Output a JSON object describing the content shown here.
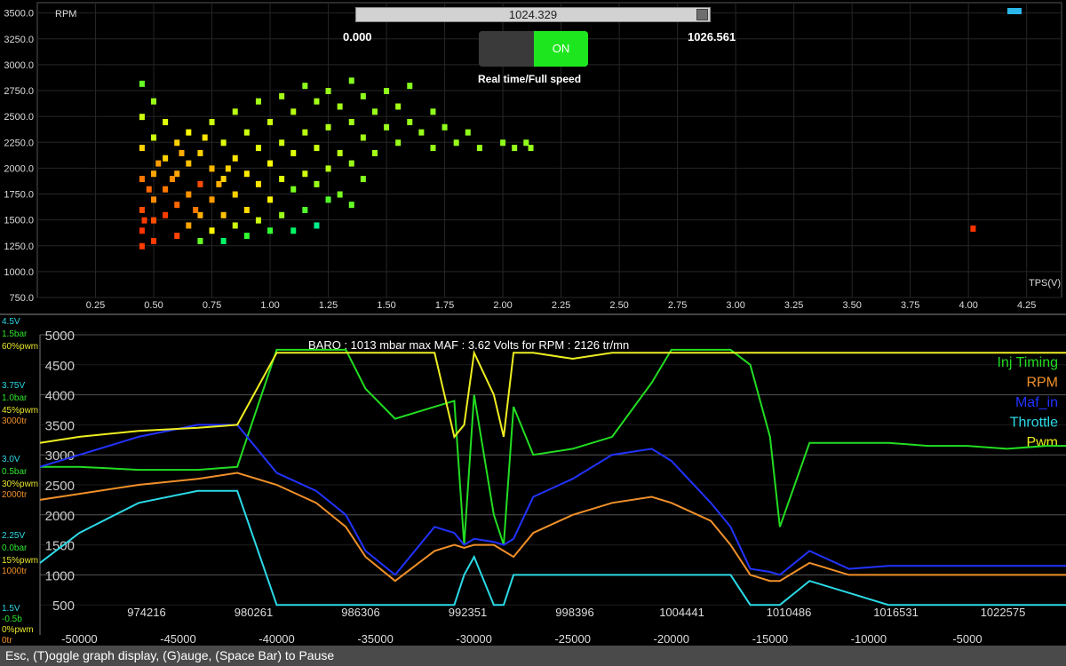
{
  "scatter": {
    "y_axis_title": "RPM",
    "x_axis_title": "TPS(V)",
    "y_ticks": [
      "3500.0",
      "3250.0",
      "3000.0",
      "2750.0",
      "2500.0",
      "2250.0",
      "2000.0",
      "1750.0",
      "1500.0",
      "1250.0",
      "1000.0",
      "750.0"
    ],
    "x_ticks": [
      "0.25",
      "0.50",
      "0.75",
      "1.00",
      "1.25",
      "1.50",
      "1.75",
      "2.00",
      "2.25",
      "2.50",
      "2.75",
      "3.00",
      "3.25",
      "3.50",
      "3.75",
      "4.00",
      "4.25"
    ],
    "xlim": [
      0.0,
      4.4
    ],
    "ylim": [
      750,
      3600
    ]
  },
  "slider": {
    "value": "1024.329",
    "min_label": "0.000",
    "max_label": "1026.561",
    "fraction": 0.997
  },
  "toggle": {
    "state_label": "ON",
    "caption": "Real time/Full speed"
  },
  "colorbar": {
    "ticks": [
      "0",
      "25",
      "50",
      "75",
      "100"
    ],
    "colors": [
      "#0000ff",
      "#00d4ff",
      "#00ff40",
      "#ffff00",
      "#ff2000"
    ]
  },
  "timeseries": {
    "header": "BARO : 1013 mbar   max MAF  : 3.62 Volts for RPM : 2126 tr/mn",
    "y_ticks": [
      "5000",
      "4500",
      "4000",
      "3500",
      "3000",
      "2500",
      "2000",
      "1500",
      "1000",
      "500"
    ],
    "x_bottom_ticks": [
      "-50000",
      "-45000",
      "-40000",
      "-35000",
      "-30000",
      "-25000",
      "-20000",
      "-15000",
      "-10000",
      "-5000"
    ],
    "x_top_ticks": [
      "974216",
      "980261",
      "986306",
      "992351",
      "998396",
      "1004441",
      "1010486",
      "1016531",
      "1022575"
    ],
    "left_scale": [
      {
        "label": "4.5V",
        "color": "#2bd9e6"
      },
      {
        "label": "1.5bar",
        "color": "#2ee62e"
      },
      {
        "label": "60%pwm",
        "color": "#e6e62e"
      },
      {
        "label": "3.75V",
        "color": "#2bd9e6"
      },
      {
        "label": "1.0bar",
        "color": "#2ee62e"
      },
      {
        "label": "45%pwm",
        "color": "#e6e62e"
      },
      {
        "label": "3000tr",
        "color": "#f0902a"
      },
      {
        "label": "3.0V",
        "color": "#2bd9e6"
      },
      {
        "label": "0.5bar",
        "color": "#2ee62e"
      },
      {
        "label": "30%pwm",
        "color": "#e6e62e"
      },
      {
        "label": "2000tr",
        "color": "#f0902a"
      },
      {
        "label": "2.25V",
        "color": "#2bd9e6"
      },
      {
        "label": "0.0bar",
        "color": "#2ee62e"
      },
      {
        "label": "15%pwm",
        "color": "#e6e62e"
      },
      {
        "label": "1000tr",
        "color": "#f0902a"
      },
      {
        "label": "1.5V",
        "color": "#2bd9e6"
      },
      {
        "label": "-0.5b",
        "color": "#2ee62e"
      },
      {
        "label": "0%pwm",
        "color": "#e6e62e"
      },
      {
        "label": "0tr",
        "color": "#f0902a"
      }
    ],
    "legend": [
      {
        "name": "Inj Timing",
        "color": "#22dd22"
      },
      {
        "name": "RPM",
        "color": "#f0902a"
      },
      {
        "name": "Maf_in",
        "color": "#2233ff"
      },
      {
        "name": "Throttle",
        "color": "#2bd9e6"
      },
      {
        "name": "Pwm",
        "color": "#eeee22"
      }
    ]
  },
  "chart_data": [
    {
      "type": "scatter",
      "xlabel": "TPS(V)",
      "ylabel": "RPM",
      "xlim": [
        0.0,
        4.4
      ],
      "ylim": [
        750,
        3600
      ],
      "points": [
        [
          0.45,
          2820,
          60
        ],
        [
          0.45,
          2500,
          70
        ],
        [
          0.45,
          2200,
          80
        ],
        [
          0.45,
          1900,
          90
        ],
        [
          0.45,
          1600,
          95
        ],
        [
          0.45,
          1400,
          98
        ],
        [
          0.45,
          1250,
          97
        ],
        [
          0.5,
          2650,
          65
        ],
        [
          0.5,
          2300,
          70
        ],
        [
          0.5,
          1950,
          85
        ],
        [
          0.5,
          1700,
          88
        ],
        [
          0.5,
          1500,
          95
        ],
        [
          0.5,
          1300,
          97
        ],
        [
          0.55,
          2450,
          72
        ],
        [
          0.55,
          2100,
          80
        ],
        [
          0.55,
          1800,
          90
        ],
        [
          0.55,
          1550,
          97
        ],
        [
          0.6,
          2250,
          80
        ],
        [
          0.6,
          1950,
          85
        ],
        [
          0.6,
          1650,
          92
        ],
        [
          0.6,
          1350,
          96
        ],
        [
          0.65,
          2350,
          75
        ],
        [
          0.65,
          2050,
          82
        ],
        [
          0.65,
          1750,
          87
        ],
        [
          0.65,
          1450,
          85
        ],
        [
          0.7,
          2150,
          80
        ],
        [
          0.7,
          1850,
          95
        ],
        [
          0.7,
          1550,
          84
        ],
        [
          0.7,
          1300,
          60
        ],
        [
          0.75,
          2450,
          70
        ],
        [
          0.75,
          2000,
          83
        ],
        [
          0.75,
          1700,
          86
        ],
        [
          0.75,
          1400,
          76
        ],
        [
          0.8,
          2250,
          72
        ],
        [
          0.8,
          1900,
          80
        ],
        [
          0.8,
          1550,
          82
        ],
        [
          0.8,
          1300,
          45
        ],
        [
          0.85,
          2550,
          68
        ],
        [
          0.85,
          2100,
          78
        ],
        [
          0.85,
          1750,
          80
        ],
        [
          0.85,
          1450,
          70
        ],
        [
          0.9,
          2350,
          70
        ],
        [
          0.9,
          1950,
          77
        ],
        [
          0.9,
          1600,
          79
        ],
        [
          0.9,
          1350,
          55
        ],
        [
          0.95,
          2650,
          66
        ],
        [
          0.95,
          2200,
          72
        ],
        [
          0.95,
          1850,
          78
        ],
        [
          0.95,
          1500,
          70
        ],
        [
          1.0,
          2450,
          70
        ],
        [
          1.0,
          2050,
          75
        ],
        [
          1.0,
          1700,
          76
        ],
        [
          1.0,
          1400,
          55
        ],
        [
          1.05,
          2700,
          66
        ],
        [
          1.05,
          2250,
          70
        ],
        [
          1.05,
          1900,
          72
        ],
        [
          1.05,
          1550,
          65
        ],
        [
          1.1,
          2550,
          68
        ],
        [
          1.1,
          2150,
          72
        ],
        [
          1.1,
          1800,
          62
        ],
        [
          1.1,
          1400,
          45
        ],
        [
          1.15,
          2800,
          64
        ],
        [
          1.15,
          2350,
          68
        ],
        [
          1.15,
          1950,
          70
        ],
        [
          1.15,
          1600,
          58
        ],
        [
          1.2,
          2650,
          66
        ],
        [
          1.2,
          2200,
          70
        ],
        [
          1.2,
          1850,
          65
        ],
        [
          1.2,
          1450,
          40
        ],
        [
          1.25,
          2750,
          65
        ],
        [
          1.25,
          2400,
          67
        ],
        [
          1.25,
          2000,
          68
        ],
        [
          1.25,
          1700,
          58
        ],
        [
          1.3,
          2600,
          66
        ],
        [
          1.3,
          2150,
          68
        ],
        [
          1.3,
          1750,
          62
        ],
        [
          1.35,
          2850,
          63
        ],
        [
          1.35,
          2450,
          66
        ],
        [
          1.35,
          2050,
          65
        ],
        [
          1.35,
          1650,
          60
        ],
        [
          1.4,
          2700,
          64
        ],
        [
          1.4,
          2300,
          66
        ],
        [
          1.4,
          1900,
          63
        ],
        [
          1.45,
          2550,
          65
        ],
        [
          1.45,
          2150,
          66
        ],
        [
          1.5,
          2750,
          64
        ],
        [
          1.5,
          2400,
          65
        ],
        [
          1.55,
          2600,
          66
        ],
        [
          1.55,
          2250,
          65
        ],
        [
          1.6,
          2800,
          63
        ],
        [
          1.6,
          2450,
          65
        ],
        [
          1.65,
          2350,
          65
        ],
        [
          1.7,
          2550,
          64
        ],
        [
          1.7,
          2200,
          65
        ],
        [
          1.75,
          2400,
          64
        ],
        [
          1.8,
          2250,
          65
        ],
        [
          1.85,
          2350,
          64
        ],
        [
          1.9,
          2200,
          65
        ],
        [
          2.0,
          2250,
          64
        ],
        [
          2.05,
          2200,
          65
        ],
        [
          2.1,
          2250,
          64
        ],
        [
          2.12,
          2200,
          65
        ],
        [
          4.02,
          1420,
          98
        ],
        [
          0.46,
          1500,
          97
        ],
        [
          0.48,
          1800,
          92
        ],
        [
          0.52,
          2050,
          86
        ],
        [
          0.58,
          1900,
          88
        ],
        [
          0.62,
          2150,
          84
        ],
        [
          0.68,
          1600,
          90
        ],
        [
          0.72,
          2300,
          78
        ],
        [
          0.78,
          1850,
          84
        ],
        [
          0.82,
          2000,
          80
        ]
      ]
    },
    {
      "type": "line",
      "xlabel": "",
      "ylabel": "",
      "x": [
        -52000,
        -50000,
        -47000,
        -44000,
        -42000,
        -40000,
        -38000,
        -36500,
        -35500,
        -34000,
        -32000,
        -31000,
        -30500,
        -30000,
        -29000,
        -28500,
        -28000,
        -27000,
        -25000,
        -23000,
        -21000,
        -20000,
        -18000,
        -17000,
        -16000,
        -15000,
        -14500,
        -13000,
        -11000,
        -9000,
        -7000,
        -5000,
        -3000,
        -1000,
        0
      ],
      "series": [
        {
          "name": "Inj Timing",
          "values": [
            2800,
            2800,
            2750,
            2750,
            2800,
            4750,
            4750,
            4750,
            4100,
            3600,
            3800,
            3900,
            1500,
            4000,
            2000,
            1500,
            3800,
            3000,
            3100,
            3300,
            4200,
            4750,
            4750,
            4750,
            4500,
            3300,
            1800,
            3200,
            3200,
            3200,
            3150,
            3150,
            3100,
            3150,
            3150
          ]
        },
        {
          "name": "RPM",
          "values": [
            2250,
            2350,
            2500,
            2600,
            2700,
            2500,
            2200,
            1800,
            1300,
            900,
            1400,
            1500,
            1450,
            1500,
            1500,
            1400,
            1300,
            1700,
            2000,
            2200,
            2300,
            2200,
            1900,
            1500,
            1000,
            900,
            900,
            1200,
            1000,
            1000,
            1000,
            1000,
            1000,
            1000,
            1000
          ]
        },
        {
          "name": "Maf_in",
          "values": [
            2800,
            3000,
            3300,
            3500,
            3500,
            2700,
            2400,
            2000,
            1400,
            1000,
            1800,
            1700,
            1500,
            1600,
            1550,
            1500,
            1600,
            2300,
            2600,
            3000,
            3100,
            2900,
            2200,
            1800,
            1100,
            1050,
            1000,
            1400,
            1100,
            1150,
            1150,
            1150,
            1150,
            1150,
            1150
          ]
        },
        {
          "name": "Throttle",
          "values": [
            1200,
            1700,
            2200,
            2400,
            2400,
            500,
            500,
            500,
            500,
            500,
            500,
            500,
            1000,
            1300,
            500,
            500,
            1000,
            1000,
            1000,
            1000,
            1000,
            1000,
            1000,
            1000,
            500,
            500,
            500,
            900,
            700,
            500,
            500,
            500,
            500,
            500,
            500
          ]
        },
        {
          "name": "Pwm",
          "values": [
            3200,
            3300,
            3400,
            3450,
            3500,
            4700,
            4700,
            4700,
            4700,
            4700,
            4700,
            3300,
            3500,
            4700,
            4000,
            3300,
            4700,
            4700,
            4600,
            4700,
            4700,
            4700,
            4700,
            4700,
            4700,
            4700,
            4700,
            4700,
            4700,
            4700,
            4700,
            4700,
            4700,
            4700,
            4700
          ]
        }
      ],
      "ylim": [
        0,
        5000
      ],
      "xlim": [
        -52000,
        0
      ],
      "grid": true,
      "legend_placement": "right"
    }
  ],
  "status_bar": {
    "text": "Esc, (T)oggle graph display, (G)auge, (Space Bar) to Pause"
  }
}
